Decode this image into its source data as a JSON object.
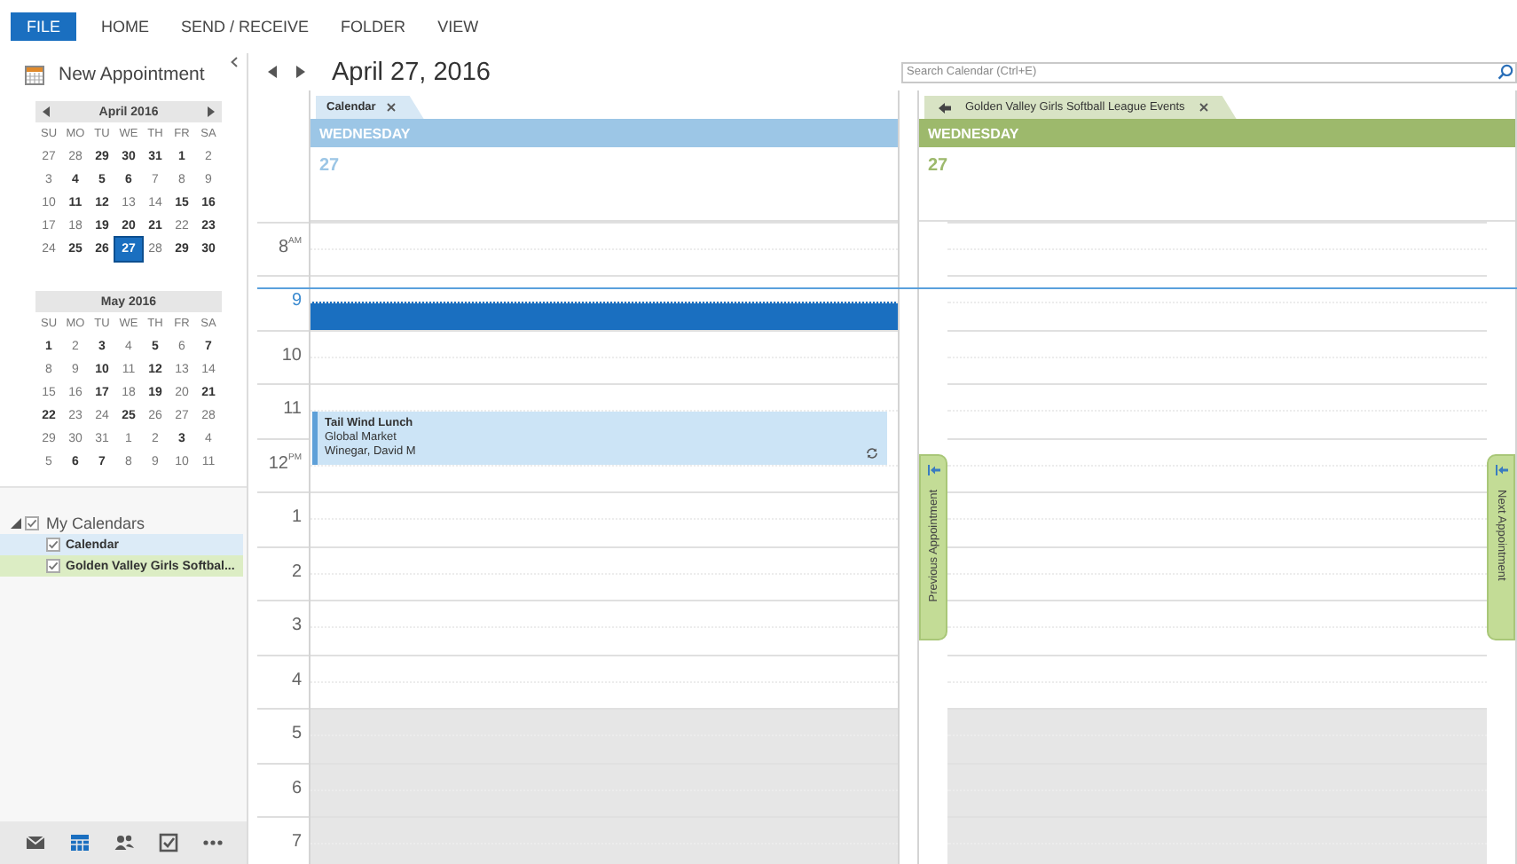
{
  "ribbon": {
    "tabs": [
      {
        "label": "FILE",
        "kind": "file"
      },
      {
        "label": "HOME",
        "kind": "tab"
      },
      {
        "label": "SEND / RECEIVE",
        "kind": "tab"
      },
      {
        "label": "FOLDER",
        "kind": "tab"
      },
      {
        "label": "VIEW",
        "kind": "tab"
      }
    ]
  },
  "sidebar": {
    "new_appointment": "New Appointment",
    "mini_calendars": [
      {
        "title": "April 2016",
        "arrows": true,
        "weekdays": [
          "SU",
          "MO",
          "TU",
          "WE",
          "TH",
          "FR",
          "SA"
        ],
        "weeks": [
          [
            {
              "day": "27",
              "busy": false,
              "selected": false
            },
            {
              "day": "28",
              "busy": false,
              "selected": false
            },
            {
              "day": "29",
              "busy": true,
              "selected": false
            },
            {
              "day": "30",
              "busy": true,
              "selected": false
            },
            {
              "day": "31",
              "busy": true,
              "selected": false
            },
            {
              "day": "1",
              "busy": true,
              "selected": false
            },
            {
              "day": "2",
              "busy": false,
              "selected": false
            }
          ],
          [
            {
              "day": "3",
              "busy": false,
              "selected": false
            },
            {
              "day": "4",
              "busy": true,
              "selected": false
            },
            {
              "day": "5",
              "busy": true,
              "selected": false
            },
            {
              "day": "6",
              "busy": true,
              "selected": false
            },
            {
              "day": "7",
              "busy": false,
              "selected": false
            },
            {
              "day": "8",
              "busy": false,
              "selected": false
            },
            {
              "day": "9",
              "busy": false,
              "selected": false
            }
          ],
          [
            {
              "day": "10",
              "busy": false,
              "selected": false
            },
            {
              "day": "11",
              "busy": true,
              "selected": false
            },
            {
              "day": "12",
              "busy": true,
              "selected": false
            },
            {
              "day": "13",
              "busy": false,
              "selected": false
            },
            {
              "day": "14",
              "busy": false,
              "selected": false
            },
            {
              "day": "15",
              "busy": true,
              "selected": false
            },
            {
              "day": "16",
              "busy": true,
              "selected": false
            }
          ],
          [
            {
              "day": "17",
              "busy": false,
              "selected": false
            },
            {
              "day": "18",
              "busy": false,
              "selected": false
            },
            {
              "day": "19",
              "busy": true,
              "selected": false
            },
            {
              "day": "20",
              "busy": true,
              "selected": false
            },
            {
              "day": "21",
              "busy": true,
              "selected": false
            },
            {
              "day": "22",
              "busy": false,
              "selected": false
            },
            {
              "day": "23",
              "busy": true,
              "selected": false
            }
          ],
          [
            {
              "day": "24",
              "busy": false,
              "selected": false
            },
            {
              "day": "25",
              "busy": true,
              "selected": false
            },
            {
              "day": "26",
              "busy": true,
              "selected": false
            },
            {
              "day": "27",
              "busy": true,
              "selected": true
            },
            {
              "day": "28",
              "busy": false,
              "selected": false
            },
            {
              "day": "29",
              "busy": true,
              "selected": false
            },
            {
              "day": "30",
              "busy": true,
              "selected": false
            }
          ]
        ]
      },
      {
        "title": "May 2016",
        "arrows": false,
        "weekdays": [
          "SU",
          "MO",
          "TU",
          "WE",
          "TH",
          "FR",
          "SA"
        ],
        "weeks": [
          [
            {
              "day": "1",
              "busy": true,
              "selected": false
            },
            {
              "day": "2",
              "busy": false,
              "selected": false
            },
            {
              "day": "3",
              "busy": true,
              "selected": false
            },
            {
              "day": "4",
              "busy": false,
              "selected": false
            },
            {
              "day": "5",
              "busy": true,
              "selected": false
            },
            {
              "day": "6",
              "busy": false,
              "selected": false
            },
            {
              "day": "7",
              "busy": true,
              "selected": false
            }
          ],
          [
            {
              "day": "8",
              "busy": false,
              "selected": false
            },
            {
              "day": "9",
              "busy": false,
              "selected": false
            },
            {
              "day": "10",
              "busy": true,
              "selected": false
            },
            {
              "day": "11",
              "busy": false,
              "selected": false
            },
            {
              "day": "12",
              "busy": true,
              "selected": false
            },
            {
              "day": "13",
              "busy": false,
              "selected": false
            },
            {
              "day": "14",
              "busy": false,
              "selected": false
            }
          ],
          [
            {
              "day": "15",
              "busy": false,
              "selected": false
            },
            {
              "day": "16",
              "busy": false,
              "selected": false
            },
            {
              "day": "17",
              "busy": true,
              "selected": false
            },
            {
              "day": "18",
              "busy": false,
              "selected": false
            },
            {
              "day": "19",
              "busy": true,
              "selected": false
            },
            {
              "day": "20",
              "busy": false,
              "selected": false
            },
            {
              "day": "21",
              "busy": true,
              "selected": false
            }
          ],
          [
            {
              "day": "22",
              "busy": true,
              "selected": false
            },
            {
              "day": "23",
              "busy": false,
              "selected": false
            },
            {
              "day": "24",
              "busy": false,
              "selected": false
            },
            {
              "day": "25",
              "busy": true,
              "selected": false
            },
            {
              "day": "26",
              "busy": false,
              "selected": false
            },
            {
              "day": "27",
              "busy": false,
              "selected": false
            },
            {
              "day": "28",
              "busy": false,
              "selected": false
            }
          ],
          [
            {
              "day": "29",
              "busy": false,
              "selected": false
            },
            {
              "day": "30",
              "busy": false,
              "selected": false
            },
            {
              "day": "31",
              "busy": false,
              "selected": false
            },
            {
              "day": "1",
              "busy": false,
              "selected": false
            },
            {
              "day": "2",
              "busy": false,
              "selected": false
            },
            {
              "day": "3",
              "busy": true,
              "selected": false
            },
            {
              "day": "4",
              "busy": false,
              "selected": false
            }
          ],
          [
            {
              "day": "5",
              "busy": false,
              "selected": false
            },
            {
              "day": "6",
              "busy": true,
              "selected": false
            },
            {
              "day": "7",
              "busy": true,
              "selected": false
            },
            {
              "day": "8",
              "busy": false,
              "selected": false
            },
            {
              "day": "9",
              "busy": false,
              "selected": false
            },
            {
              "day": "10",
              "busy": false,
              "selected": false
            },
            {
              "day": "11",
              "busy": false,
              "selected": false
            }
          ]
        ]
      }
    ],
    "calendar_groups": [
      {
        "name": "My Calendars",
        "expanded": true,
        "checked": true,
        "items": [
          {
            "name": "Calendar",
            "checked": true,
            "color": "#dcebf7"
          },
          {
            "name": "Golden Valley Girls Softbal...",
            "checked": true,
            "color": "#dcedc4"
          }
        ]
      }
    ]
  },
  "navigation": [
    {
      "kind": "mail",
      "selected": false
    },
    {
      "kind": "calendar",
      "selected": true
    },
    {
      "kind": "people",
      "selected": false
    },
    {
      "kind": "tasks",
      "selected": false
    },
    {
      "kind": "more",
      "selected": false
    }
  ],
  "main": {
    "title": "April 27, 2016",
    "search": {
      "placeholder": "Search Calendar (Ctrl+E)"
    },
    "hours": [
      {
        "hour": "8",
        "suffix": "AM",
        "after_hours": false,
        "current": false
      },
      {
        "hour": "9",
        "after_hours": false,
        "current": true
      },
      {
        "hour": "10",
        "after_hours": false,
        "current": false
      },
      {
        "hour": "11",
        "after_hours": false,
        "current": false
      },
      {
        "hour": "12",
        "suffix": "PM",
        "after_hours": false,
        "current": false
      },
      {
        "hour": "1",
        "after_hours": false,
        "current": false
      },
      {
        "hour": "2",
        "after_hours": false,
        "current": false
      },
      {
        "hour": "3",
        "after_hours": false,
        "current": false
      },
      {
        "hour": "4",
        "after_hours": false,
        "current": false
      },
      {
        "hour": "5",
        "after_hours": true,
        "current": false
      },
      {
        "hour": "6",
        "after_hours": true,
        "current": false
      },
      {
        "hour": "7",
        "after_hours": true,
        "current": false
      }
    ],
    "panes": [
      {
        "tab": "Calendar",
        "overlay_arrow": false,
        "color": "#9cc6e6",
        "weekday": "WEDNESDAY",
        "date": "27",
        "slots": [
          {
            "selected": false
          },
          {
            "selected": false
          },
          {
            "selected": false
          },
          {
            "selected": true
          },
          {
            "selected": false
          },
          {
            "selected": false
          },
          {
            "selected": false
          },
          {
            "selected": false,
            "event": {
              "title": "Tail Wind Lunch",
              "location": "Global Market",
              "organizer": "Winegar, David M",
              "recurring": true
            }
          },
          {
            "selected": false
          },
          {
            "selected": false
          },
          {
            "selected": false
          },
          {
            "selected": false
          },
          {
            "selected": false
          },
          {
            "selected": false
          },
          {
            "selected": false
          },
          {
            "selected": false
          },
          {
            "selected": false
          },
          {
            "selected": false
          },
          {
            "selected": false
          },
          {
            "selected": false
          },
          {
            "selected": false
          },
          {
            "selected": false
          },
          {
            "selected": false
          }
        ]
      },
      {
        "tab": "Golden Valley Girls Softball League Events",
        "overlay_arrow": true,
        "color": "#9db96c",
        "weekday": "WEDNESDAY",
        "date": "27",
        "previous": "Previous Appointment",
        "next": "Next Appointment",
        "slots": [
          {
            "selected": false
          },
          {
            "selected": false
          },
          {
            "selected": false
          },
          {
            "selected": false
          },
          {
            "selected": false
          },
          {
            "selected": false
          },
          {
            "selected": false
          },
          {
            "selected": false
          },
          {
            "selected": false
          },
          {
            "selected": false
          },
          {
            "selected": false
          },
          {
            "selected": false
          },
          {
            "selected": false
          },
          {
            "selected": false
          },
          {
            "selected": false
          },
          {
            "selected": false
          },
          {
            "selected": false
          },
          {
            "selected": false
          },
          {
            "selected": false
          },
          {
            "selected": false
          },
          {
            "selected": false
          },
          {
            "selected": false
          },
          {
            "selected": false
          },
          {
            "selected": false
          }
        ]
      }
    ]
  }
}
